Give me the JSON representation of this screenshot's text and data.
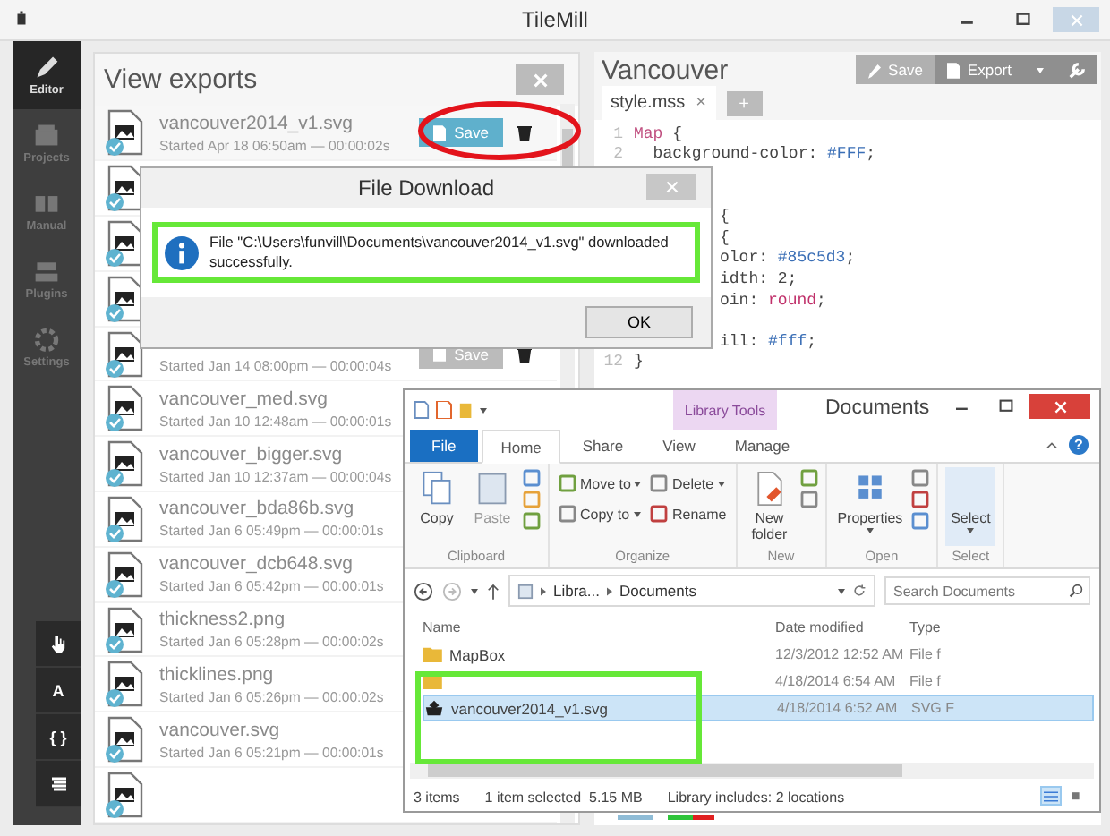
{
  "window": {
    "title": "TileMill"
  },
  "sidebar": {
    "items": [
      {
        "label": "Editor",
        "selected": true
      },
      {
        "label": "Projects",
        "selected": false
      },
      {
        "label": "Manual",
        "selected": false
      },
      {
        "label": "Plugins",
        "selected": false
      },
      {
        "label": "Settings",
        "selected": false
      }
    ],
    "tools": [
      {
        "kind": "hand"
      },
      {
        "kind": "text",
        "label": "A"
      },
      {
        "kind": "text",
        "label": "{ }"
      },
      {
        "kind": "layers"
      }
    ]
  },
  "exports": {
    "title": "View exports",
    "rows": [
      {
        "name": "vancouver2014_v1.svg",
        "started": "Started Apr 18 06:50am — 00:00:02s",
        "save": "Save",
        "hovered": true
      },
      {},
      {},
      {},
      {
        "started": "Started Jan 14 08:00pm — 00:00:04s",
        "save": "Save",
        "hovered": false
      },
      {
        "name": "vancouver_med.svg",
        "started": "Started Jan 10 12:48am — 00:00:01s"
      },
      {
        "name": "vancouver_bigger.svg",
        "started": "Started Jan 10 12:37am — 00:00:04s"
      },
      {
        "name": "vancouver_bda86b.svg",
        "started": "Started Jan 6 05:49pm — 00:00:01s"
      },
      {
        "name": "vancouver_dcb648.svg",
        "started": "Started Jan 6 05:42pm — 00:00:01s"
      },
      {
        "name": "thickness2.png",
        "started": "Started Jan 6 05:28pm — 00:00:02s"
      },
      {
        "name": "thicklines.png",
        "started": "Started Jan 6 05:26pm — 00:00:02s"
      },
      {
        "name": "vancouver.svg",
        "started": "Started Jan 6 05:21pm — 00:00:01s"
      },
      {}
    ]
  },
  "editor": {
    "title": "Vancouver",
    "buttons": [
      {
        "label": "Save",
        "disabled": true
      },
      {
        "label": "Export",
        "disabled": false
      }
    ],
    "tabs": [
      {
        "label": "style.mss",
        "close": "×",
        "selected": true
      }
    ],
    "add_tab": "+",
    "lines": [
      {
        "kind": "full",
        "number": "1",
        "parts": [
          {
            "kind": "selector",
            "text": "Map"
          },
          {
            "kind": "plain",
            "text": " {"
          }
        ]
      },
      {
        "kind": "full",
        "number": "2",
        "parts": [
          {
            "kind": "plain",
            "text": "  background-color: "
          },
          {
            "kind": "color",
            "text": "#FFF"
          },
          {
            "kind": "plain",
            "text": ";"
          }
        ]
      },
      {
        "kind": "hidden"
      },
      {
        "kind": "hidden"
      },
      {
        "kind": "tail",
        "parts": [
          {
            "kind": "plain",
            "text": "{"
          }
        ]
      },
      {
        "kind": "tail",
        "parts": [
          {
            "kind": "plain",
            "text": "{"
          }
        ]
      },
      {
        "kind": "tail",
        "parts": [
          {
            "kind": "plain",
            "text": "olor: "
          },
          {
            "kind": "color",
            "text": "#85c5d3"
          },
          {
            "kind": "plain",
            "text": ";"
          }
        ]
      },
      {
        "kind": "tail",
        "parts": [
          {
            "kind": "plain",
            "text": "idth: 2;"
          }
        ]
      },
      {
        "kind": "tail",
        "parts": [
          {
            "kind": "plain",
            "text": "oin: "
          },
          {
            "kind": "keyword",
            "text": "round"
          },
          {
            "kind": "plain",
            "text": ";"
          }
        ]
      },
      {
        "kind": "hidden"
      },
      {
        "kind": "tail",
        "parts": [
          {
            "kind": "plain",
            "text": "ill: "
          },
          {
            "kind": "color",
            "text": "#fff"
          },
          {
            "kind": "plain",
            "text": ";"
          }
        ]
      },
      {
        "kind": "full",
        "number": "12",
        "parts": [
          {
            "kind": "plain",
            "text": "}"
          }
        ]
      }
    ]
  },
  "dialog": {
    "title": "File Download",
    "message": "File \"C:\\Users\\funvill\\Documents\\vancouver2014_v1.svg\" downloaded successfully.",
    "button": "OK"
  },
  "explorer": {
    "title": "Documents",
    "context_tab": "Library Tools",
    "tabs": [
      {
        "label": "File",
        "kind": "file",
        "selected": false
      },
      {
        "label": "Home",
        "kind": "tab",
        "selected": true
      },
      {
        "label": "Share",
        "kind": "tab",
        "selected": false
      },
      {
        "label": "View",
        "kind": "tab",
        "selected": false
      },
      {
        "label": "Manage",
        "kind": "tab",
        "selected": false
      }
    ],
    "help": "?",
    "groups": [
      {
        "label": "Clipboard",
        "buttons": [
          {
            "kind": "large",
            "label": "Copy"
          },
          {
            "kind": "large",
            "label": "Paste",
            "disabled": true
          },
          {
            "kind": "stack"
          }
        ]
      },
      {
        "label": "Organize",
        "buttons": [
          {
            "kind": "column",
            "items": [
              {
                "label": "Move to",
                "menu": true
              },
              {
                "label": "Copy to",
                "menu": true
              }
            ]
          },
          {
            "kind": "column",
            "items": [
              {
                "label": "Delete",
                "menu": true
              },
              {
                "label": "Rename",
                "menu": false
              }
            ]
          }
        ]
      },
      {
        "label": "New",
        "buttons": [
          {
            "kind": "large",
            "label": "New folder"
          },
          {
            "kind": "stack"
          }
        ]
      },
      {
        "label": "Open",
        "buttons": [
          {
            "kind": "large",
            "label": "Properties",
            "menu": true
          },
          {
            "kind": "stack"
          }
        ]
      },
      {
        "label": "Select",
        "buttons": [
          {
            "kind": "large",
            "label": "Select",
            "menu": true
          }
        ]
      }
    ],
    "path": [
      "Libra...",
      "Documents"
    ],
    "search": {
      "placeholder": "Search Documents"
    },
    "columns": [
      "Name",
      "Date modified",
      "Type"
    ],
    "rows": [
      {
        "kind": "folder",
        "name": "MapBox",
        "date": "12/3/2012 12:52 AM",
        "type": "File f",
        "selected": false
      },
      {
        "kind": "folder",
        "date": "4/18/2014 6:54 AM",
        "type": "File f",
        "selected": false
      },
      {
        "kind": "file",
        "name": "vancouver2014_v1.svg",
        "date": "4/18/2014 6:52 AM",
        "type": "SVG F",
        "selected": true
      }
    ],
    "status": [
      "3 items",
      "1 item selected  5.15 MB",
      "Library includes: 2 locations"
    ]
  }
}
